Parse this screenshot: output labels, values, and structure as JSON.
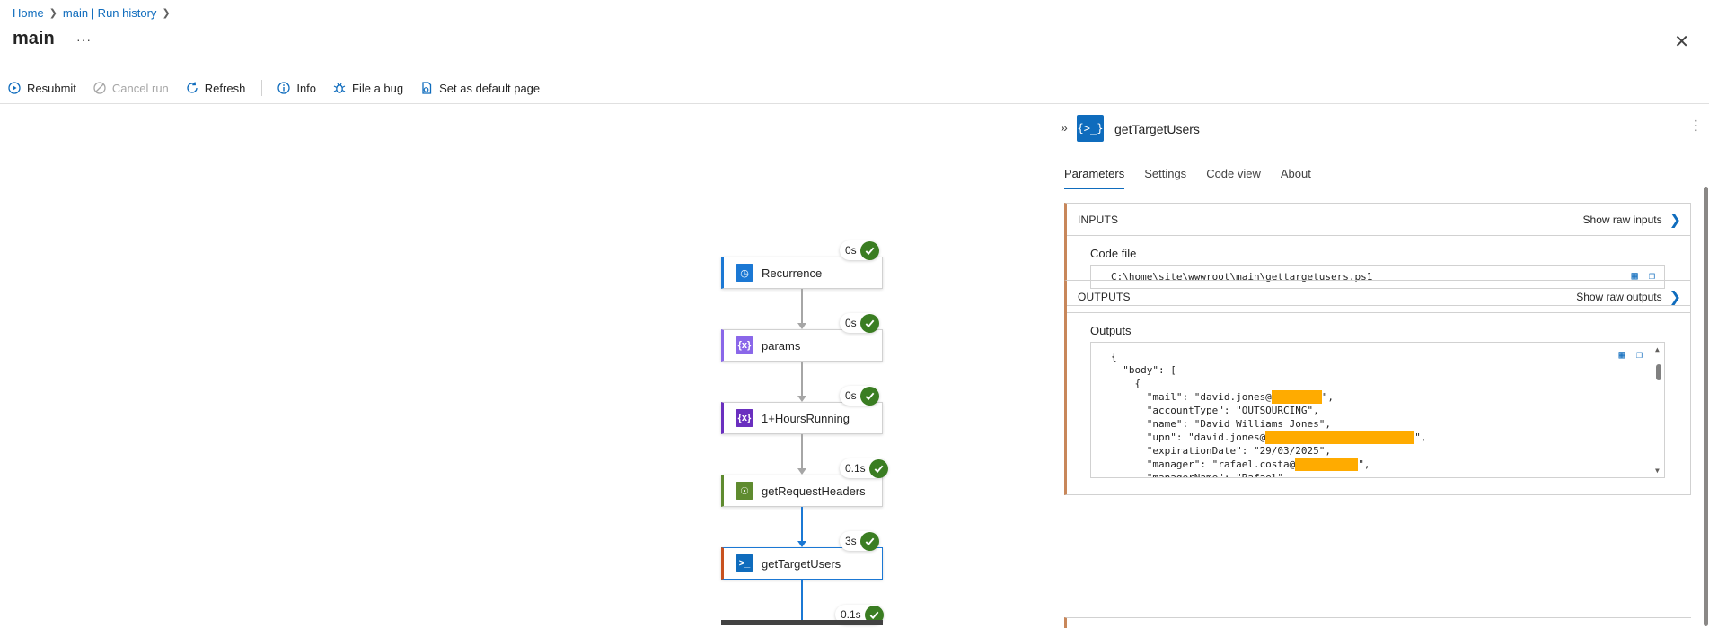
{
  "breadcrumb": {
    "home": "Home",
    "run_history": "main | Run history"
  },
  "page": {
    "title": "main",
    "more": "···"
  },
  "toolbar": {
    "resubmit": "Resubmit",
    "cancel_run": "Cancel run",
    "refresh": "Refresh",
    "info": "Info",
    "file_bug": "File a bug",
    "set_default": "Set as default page"
  },
  "flow": {
    "nodes": [
      {
        "name": "Recurrence",
        "duration": "0s",
        "icon": "clock-icon",
        "accent": "#1b78d4"
      },
      {
        "name": "params",
        "duration": "0s",
        "icon": "variable-icon",
        "accent": "#8a67e9"
      },
      {
        "name": "1+HoursRunning",
        "duration": "0s",
        "icon": "variable-icon",
        "accent": "#6a2fbf"
      },
      {
        "name": "getRequestHeaders",
        "duration": "0.1s",
        "icon": "bulb-icon",
        "accent": "#5f8b2f"
      },
      {
        "name": "getTargetUsers",
        "duration": "3s",
        "icon": "powershell-icon",
        "accent": "#0f6cbd"
      }
    ],
    "next_duration": "0.1s"
  },
  "panel": {
    "title": "getTargetUsers",
    "tabs": [
      "Parameters",
      "Settings",
      "Code view",
      "About"
    ],
    "inputs": {
      "header": "INPUTS",
      "raw_link": "Show raw inputs",
      "field_label": "Code file",
      "code_file": "C:\\home\\site\\wwwroot\\main\\gettargetusers.ps1"
    },
    "outputs": {
      "header": "OUTPUTS",
      "raw_link": "Show raw outputs",
      "field_label": "Outputs",
      "lines": [
        "{",
        "  \"body\": [",
        "    {",
        "      \"mail\": \"david.jones@",
        "      \"accountType\": \"OUTSOURCING\",",
        "      \"name\": \"David Williams Jones\",",
        "      \"upn\": \"david.jones@",
        "      \"expirationDate\": \"29/03/2025\",",
        "      \"manager\": \"rafael.costa@",
        "      \"managerName\": \"Rafael\","
      ]
    }
  }
}
